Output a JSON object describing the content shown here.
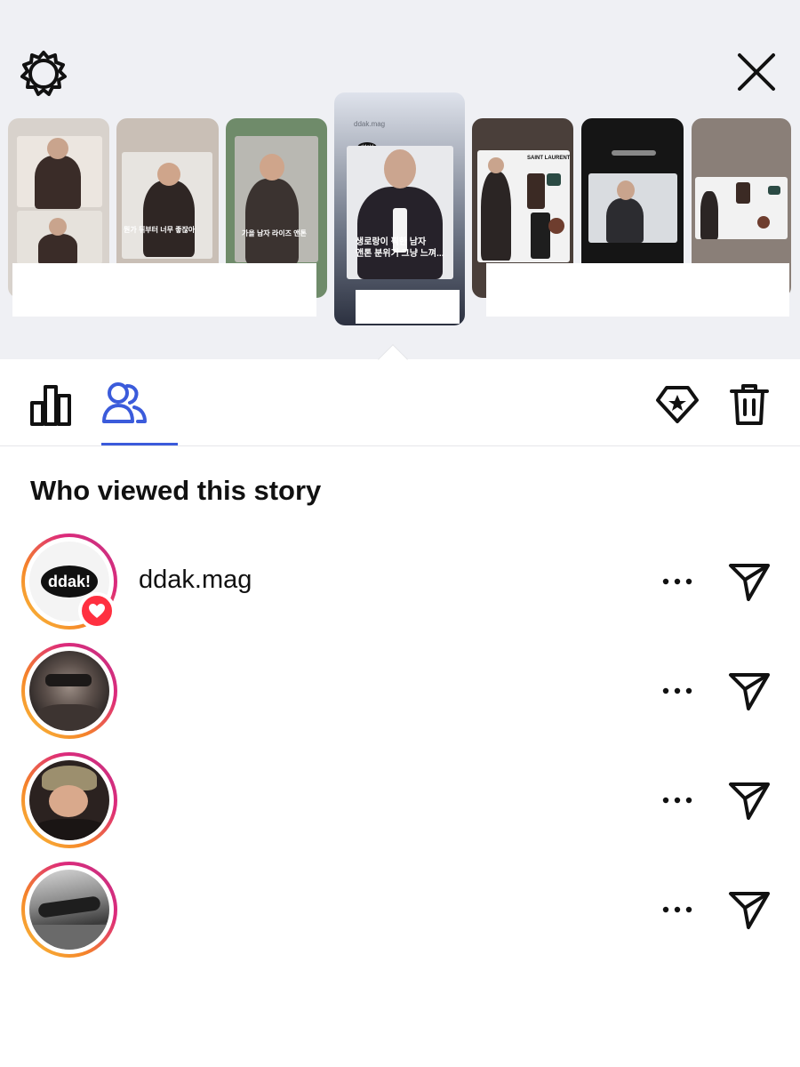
{
  "header": {
    "settings_icon": "gear-icon",
    "close_icon": "close-icon"
  },
  "story_strip": {
    "thumbnails": [
      {
        "caption": ""
      },
      {
        "caption": "뭔가 뒤부터 너무 좋잖아"
      },
      {
        "caption": "가을 남자 라이즈 앤톤"
      },
      {
        "top_label": "ddak.mag",
        "badge": "ddak!",
        "caption": "생로랑이 픽한 남자\n앤톤 분위기 그냥 느껴..."
      },
      {
        "caption": "SAINT LAURENT"
      },
      {
        "caption": ""
      },
      {
        "caption": ""
      }
    ]
  },
  "tabs": {
    "insights_icon": "bar-chart-icon",
    "viewers_icon": "people-icon",
    "highlight_icon": "star-badge-icon",
    "delete_icon": "trash-icon"
  },
  "viewers_section": {
    "title": "Who viewed this story",
    "viewers": [
      {
        "username": "ddak.mag",
        "avatar_text": "ddak!",
        "liked": true
      },
      {
        "username": "",
        "liked": false
      },
      {
        "username": "",
        "liked": false
      },
      {
        "username": "",
        "liked": false
      }
    ]
  },
  "colors": {
    "accent": "#3b5bdb",
    "like": "#ff3040",
    "background_top": "#eff0f4"
  }
}
